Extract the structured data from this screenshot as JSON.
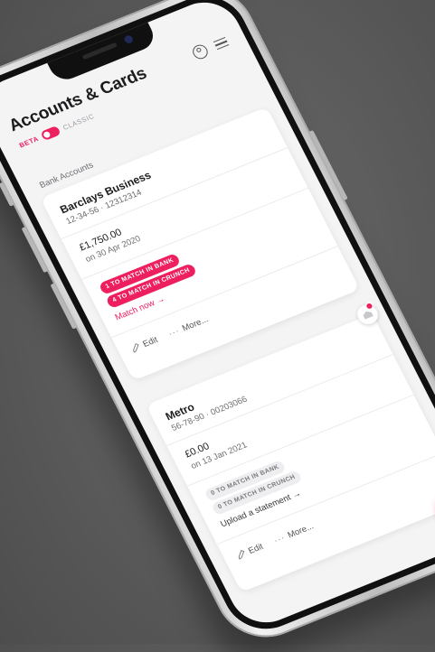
{
  "header": {
    "title": "Accounts & Cards",
    "beta_label": "BETA",
    "classic_label": "CLASSIC"
  },
  "section": {
    "label": "Bank Accounts"
  },
  "accounts": [
    {
      "name": "Barclays Business",
      "number": "12-34-56 · 12312314",
      "balance": "£1,750.00",
      "balance_date": "on 30 Apr 2020",
      "badges": [
        "1 TO MATCH IN BANK",
        "4 TO MATCH IN CRUNCH"
      ],
      "action_link": "Match now →",
      "edit_label": "Edit",
      "more_label": "More..."
    },
    {
      "name": "Metro",
      "number": "56-78-90 · 00203066",
      "balance": "£0.00",
      "balance_date": "on 13 Jan 2021",
      "badges": [
        "0 TO MATCH IN BANK",
        "0 TO MATCH IN CRUNCH"
      ],
      "action_link": "Upload a statement →",
      "edit_label": "Edit",
      "more_label": "More..."
    }
  ],
  "fab": {
    "label": "+"
  },
  "colors": {
    "accent": "#ee1f5f",
    "background": "#5a5a5a",
    "screen": "#f4f4f5"
  },
  "icons": [
    "user-icon",
    "menu-icon",
    "pencil-icon",
    "dots-icon",
    "bank-icon",
    "plus-icon"
  ]
}
